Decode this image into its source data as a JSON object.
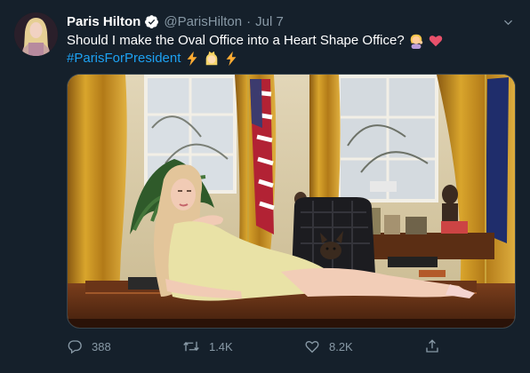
{
  "tweet": {
    "display_name": "Paris Hilton",
    "handle": "@ParisHilton",
    "separator": "·",
    "time": "Jul 7",
    "text": "Should I make the Oval Office into a Heart Shape Office?",
    "hashtag": "#ParisForPresident",
    "accent_color": "#1da1f2",
    "verified": true
  },
  "actions": {
    "replies": "388",
    "retweets": "1.4K",
    "likes": "8.2K"
  },
  "icons": {
    "verified": "verified-badge-icon",
    "more": "chevron-down-icon",
    "reply": "reply-icon",
    "retweet": "retweet-icon",
    "like": "heart-icon",
    "share": "share-icon"
  }
}
